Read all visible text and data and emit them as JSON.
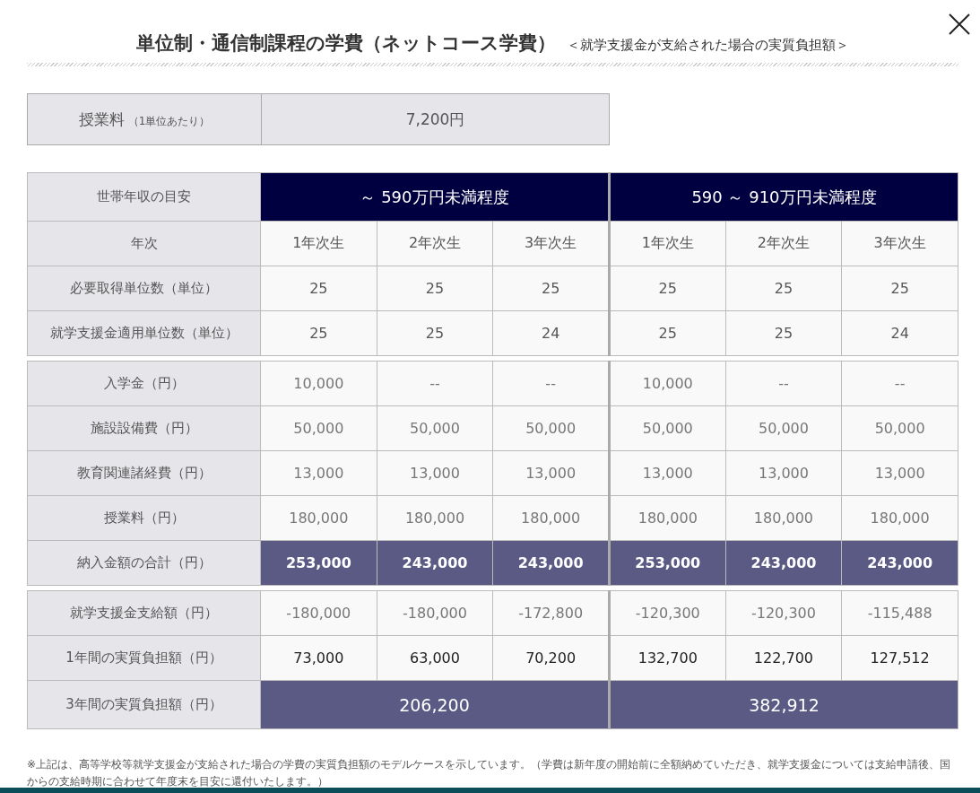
{
  "title": "単位制・通信制課程の学費（ネットコース学費）",
  "subtitle": "＜就学支援金が支給された場合の実質負担額＞",
  "tuition": {
    "label": "授業料",
    "note": "（1単位あたり）",
    "value": "7,200円"
  },
  "sections": [
    [
      {
        "kind": "groups",
        "label": "世帯年収の目安",
        "values": [
          "～ 590万円未満程度",
          "590 ～ 910万円未満程度"
        ]
      },
      {
        "kind": "normal",
        "label": "年次",
        "values": [
          "1年次生",
          "2年次生",
          "3年次生",
          "1年次生",
          "2年次生",
          "3年次生"
        ]
      },
      {
        "kind": "normal",
        "label": "必要取得単位数（単位）",
        "values": [
          "25",
          "25",
          "25",
          "25",
          "25",
          "25"
        ]
      },
      {
        "kind": "normal",
        "label": "就学支援金適用単位数（単位）",
        "values": [
          "25",
          "25",
          "24",
          "25",
          "25",
          "24"
        ]
      }
    ],
    [
      {
        "kind": "light",
        "label": "入学金（円）",
        "values": [
          "10,000",
          "--",
          "--",
          "10,000",
          "--",
          "--"
        ]
      },
      {
        "kind": "light",
        "label": "施設設備費（円）",
        "values": [
          "50,000",
          "50,000",
          "50,000",
          "50,000",
          "50,000",
          "50,000"
        ]
      },
      {
        "kind": "light",
        "label": "教育関連諸経費（円）",
        "values": [
          "13,000",
          "13,000",
          "13,000",
          "13,000",
          "13,000",
          "13,000"
        ]
      },
      {
        "kind": "light",
        "label": "授業料（円）",
        "values": [
          "180,000",
          "180,000",
          "180,000",
          "180,000",
          "180,000",
          "180,000"
        ]
      },
      {
        "kind": "total",
        "label": "納入金額の合計（円）",
        "values": [
          "253,000",
          "243,000",
          "243,000",
          "253,000",
          "243,000",
          "243,000"
        ]
      }
    ],
    [
      {
        "kind": "light",
        "label": "就学支援金支給額（円）",
        "values": [
          "-180,000",
          "-180,000",
          "-172,800",
          "-120,300",
          "-120,300",
          "-115,488"
        ]
      },
      {
        "kind": "dark",
        "label": "1年間の実質負担額（円）",
        "values": [
          "73,000",
          "63,000",
          "70,200",
          "132,700",
          "122,700",
          "127,512"
        ]
      },
      {
        "kind": "grand",
        "label": "3年間の実質負担額（円）",
        "values": [
          "206,200",
          "382,912"
        ]
      }
    ]
  ],
  "footnote": "※上記は、高等学校等就学支援金が支給された場合の学費の実質負担額のモデルケースを示しています。（学費は新年度の開始前に全額納めていただき、就学支援金については支給申請後、国からの支給時期に合わせて年度末を目安に還付いたします。）"
}
